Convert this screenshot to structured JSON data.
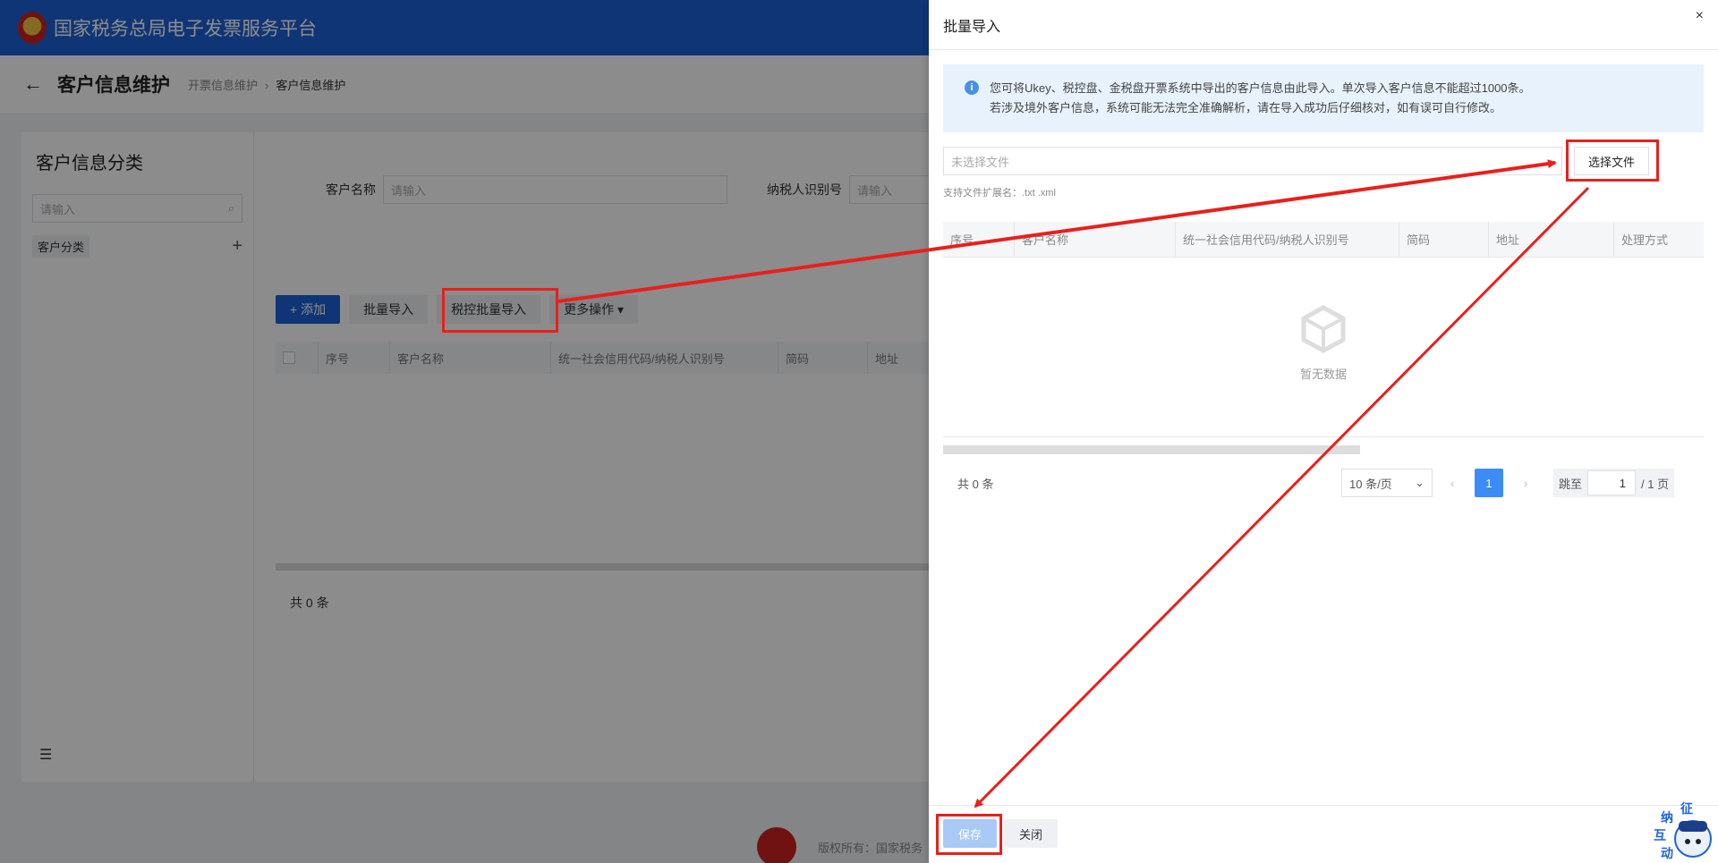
{
  "header": {
    "site_title": "国家税务总局电子发票服务平台"
  },
  "subheader": {
    "page_title": "客户信息维护",
    "breadcrumb": [
      "开票信息维护",
      "客户信息维护"
    ],
    "back_icon": "back-arrow-icon"
  },
  "left_panel": {
    "title": "客户信息分类",
    "search_placeholder": "请输入",
    "items": [
      {
        "label": "客户分类"
      }
    ]
  },
  "search_form": {
    "fields": [
      {
        "label": "客户名称",
        "placeholder": "请输入"
      },
      {
        "label": "纳税人识别号",
        "placeholder": "请输入"
      }
    ]
  },
  "toolbar": {
    "add": "+ 添加",
    "batch_import": "批量导入",
    "tax_batch_import": "税控批量导入",
    "more": "更多操作 ▾"
  },
  "main_table": {
    "columns": [
      "",
      "序号",
      "客户名称",
      "统一社会信用代码/纳税人识别号",
      "简码",
      "地址"
    ]
  },
  "main_total": "共 0 条",
  "footer": {
    "copyright": "版权所有：国家税务"
  },
  "drawer": {
    "title": "批量导入",
    "close": "×",
    "notice_line1": "您可将Ukey、税控盘、金税盘开票系统中导出的客户信息由此导入。单次导入客户信息不能超过1000条。",
    "notice_line2": "若涉及境外客户信息，系统可能无法完全准确解析，请在导入成功后仔细核对，如有误可自行修改。",
    "file_placeholder": "未选择文件",
    "choose_file": "选择文件",
    "ext_hint": "支持文件扩展名：.txt .xml",
    "columns": [
      "序号",
      "客户名称",
      "统一社会信用代码/纳税人识别号",
      "简码",
      "地址",
      "处理方式"
    ],
    "empty_text": "暂无数据",
    "pager": {
      "total": "共 0 条",
      "page_size": "10 条/页",
      "current": "1",
      "jump_label": "跳至",
      "jump_value": "1",
      "total_pages": "/ 1 页",
      "prev": "‹",
      "next": "›"
    },
    "save": "保存",
    "close_btn": "关闭"
  },
  "mascot_text": [
    "征",
    "纳",
    "互",
    "动"
  ],
  "colors": {
    "brand_blue": "#1d62d8",
    "annotation_red": "#e8201c",
    "notice_bg": "#e8f2fd"
  }
}
